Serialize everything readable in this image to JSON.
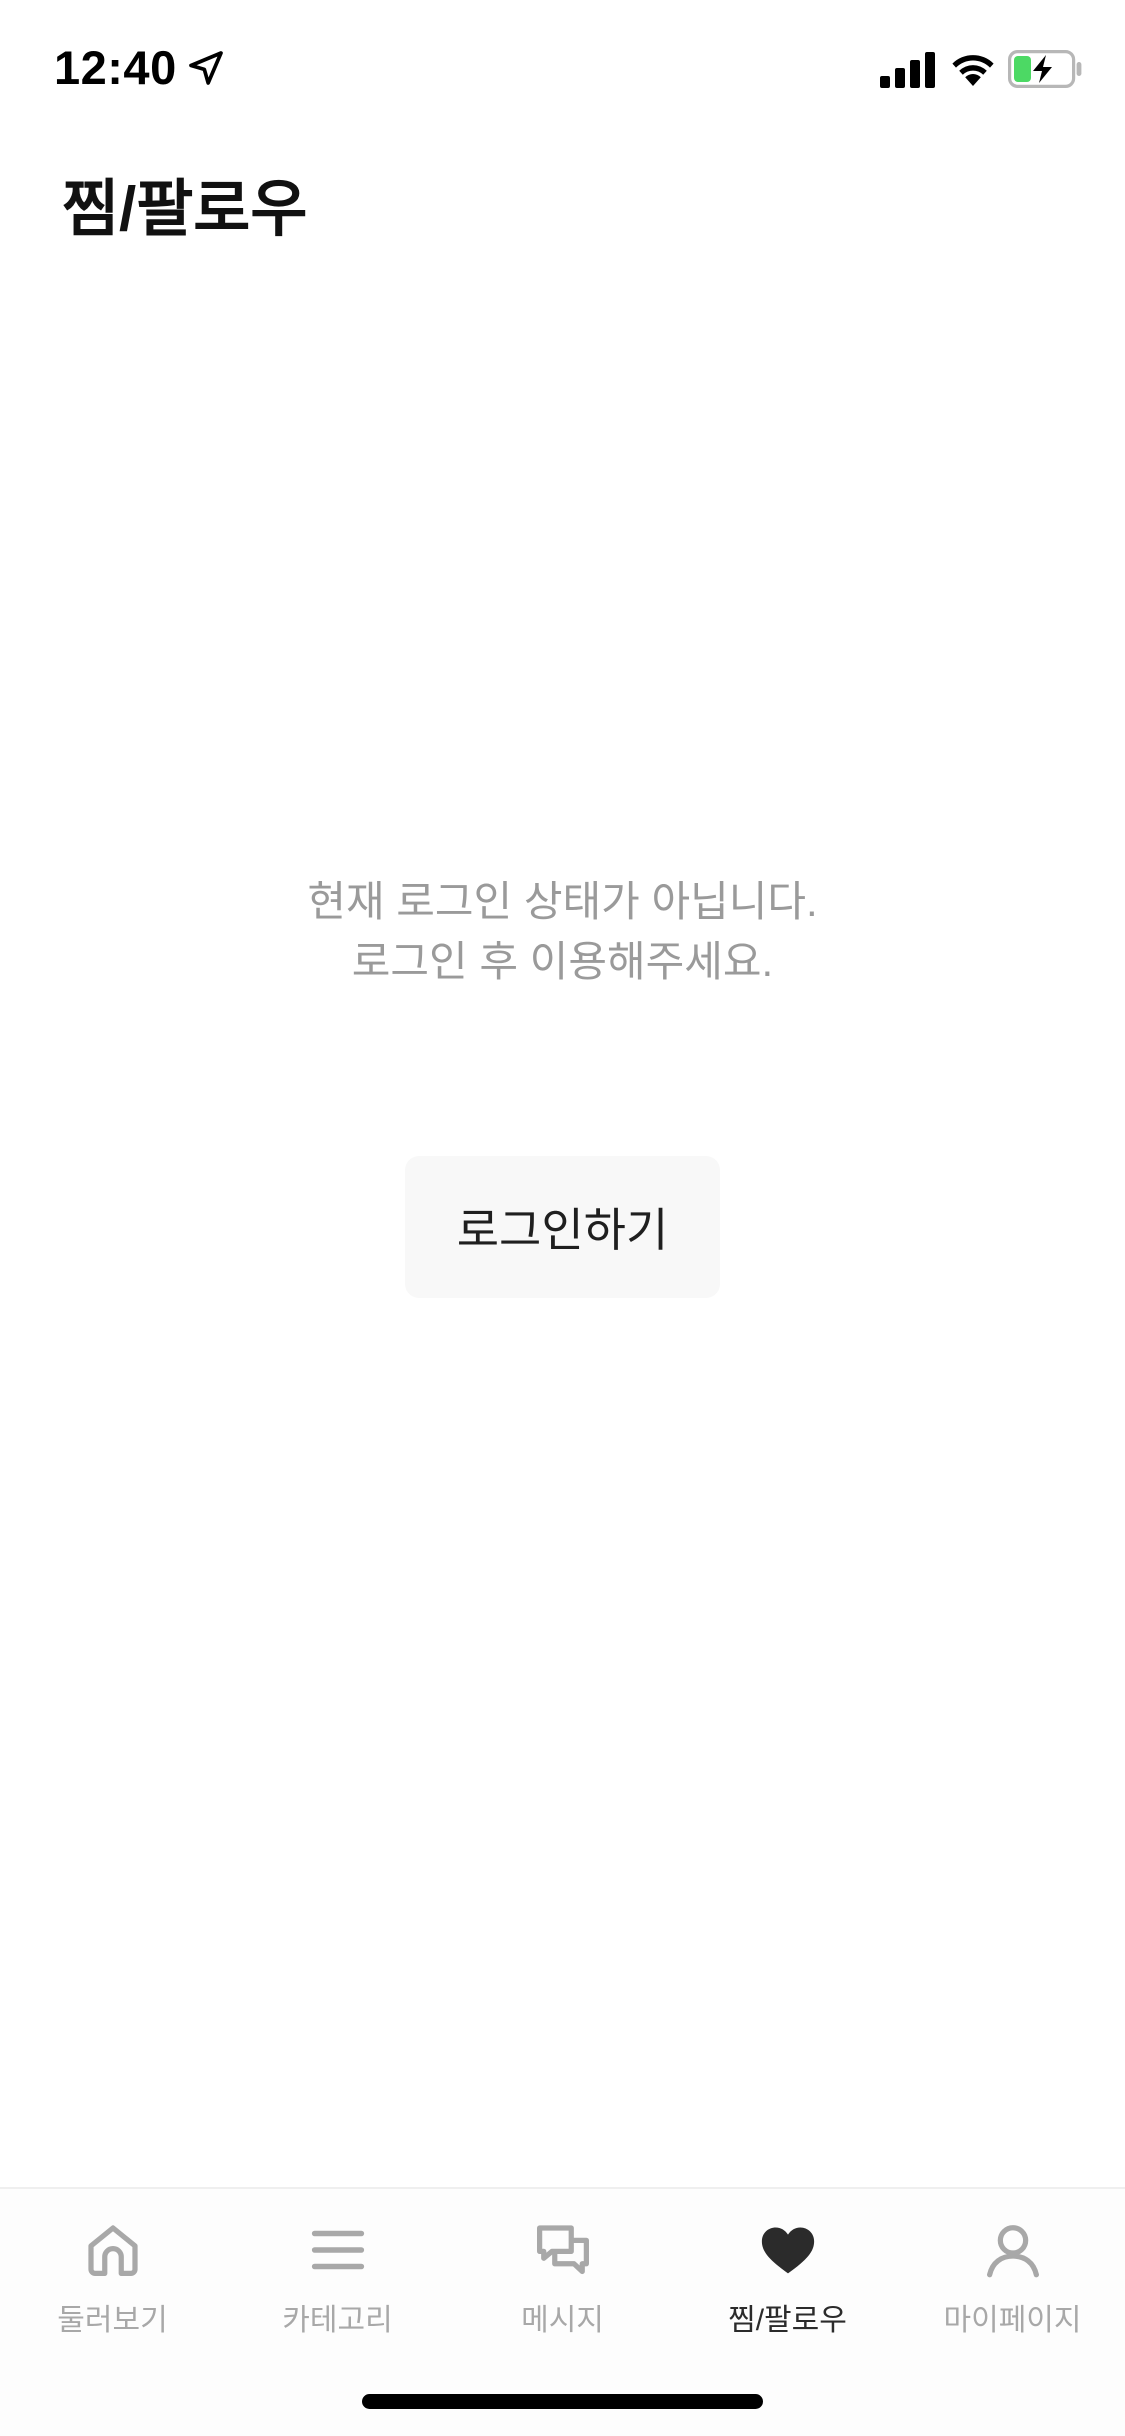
{
  "status_bar": {
    "time": "12:40",
    "icons": [
      "location-arrow-icon",
      "signal-icon",
      "wifi-icon",
      "battery-charging-icon"
    ],
    "battery_color": "#4cd964"
  },
  "header": {
    "title": "찜/팔로우"
  },
  "empty_state": {
    "line1": "현재 로그인 상태가 아닙니다.",
    "line2": "로그인 후 이용해주세요."
  },
  "login_button": {
    "label": "로그인하기"
  },
  "tab_bar": {
    "active_color": "#2b2b2b",
    "inactive_color": "#a8a8a8",
    "items": [
      {
        "label": "둘러보기",
        "icon": "home-icon",
        "active": false
      },
      {
        "label": "카테고리",
        "icon": "menu-icon",
        "active": false
      },
      {
        "label": "메시지",
        "icon": "chat-icon",
        "active": false
      },
      {
        "label": "찜/팔로우",
        "icon": "heart-icon",
        "active": true
      },
      {
        "label": "마이페이지",
        "icon": "user-icon",
        "active": false
      }
    ]
  }
}
